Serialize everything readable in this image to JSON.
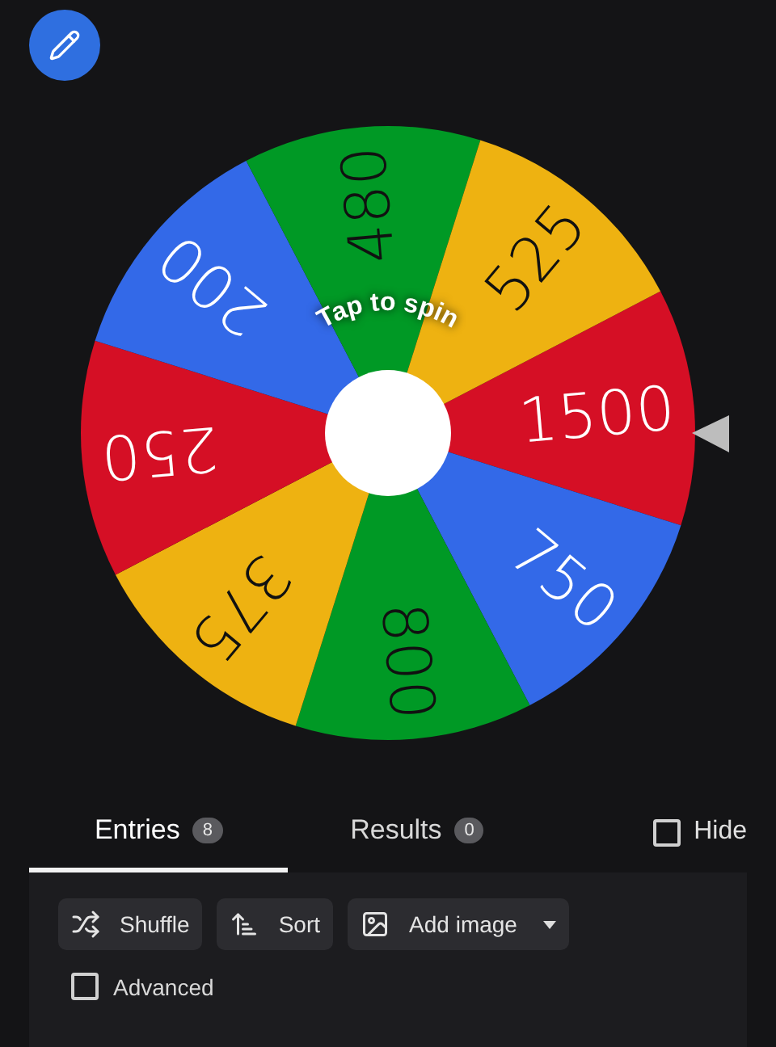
{
  "wheel": {
    "hint": "Tap to spin",
    "slices": [
      {
        "label": "1500",
        "color": "#d50f25"
      },
      {
        "label": "750",
        "color": "#3369e8"
      },
      {
        "label": "800",
        "color": "#009925"
      },
      {
        "label": "375",
        "color": "#eeb211"
      },
      {
        "label": "250",
        "color": "#d50f25"
      },
      {
        "label": "200",
        "color": "#3369e8"
      },
      {
        "label": "480",
        "color": "#009925"
      },
      {
        "label": "525",
        "color": "#eeb211"
      }
    ]
  },
  "tabs": [
    {
      "label": "Entries",
      "count": "8",
      "selected": true
    },
    {
      "label": "Results",
      "count": "0",
      "selected": false
    }
  ],
  "hide": {
    "label": "Hide",
    "checked": false
  },
  "toolbar": [
    {
      "label": "Shuffle",
      "kind": "shuffle"
    },
    {
      "label": "Sort",
      "kind": "sort"
    },
    {
      "label": "Add image",
      "kind": "image"
    }
  ],
  "advanced": {
    "label": "Advanced",
    "checked": false
  }
}
